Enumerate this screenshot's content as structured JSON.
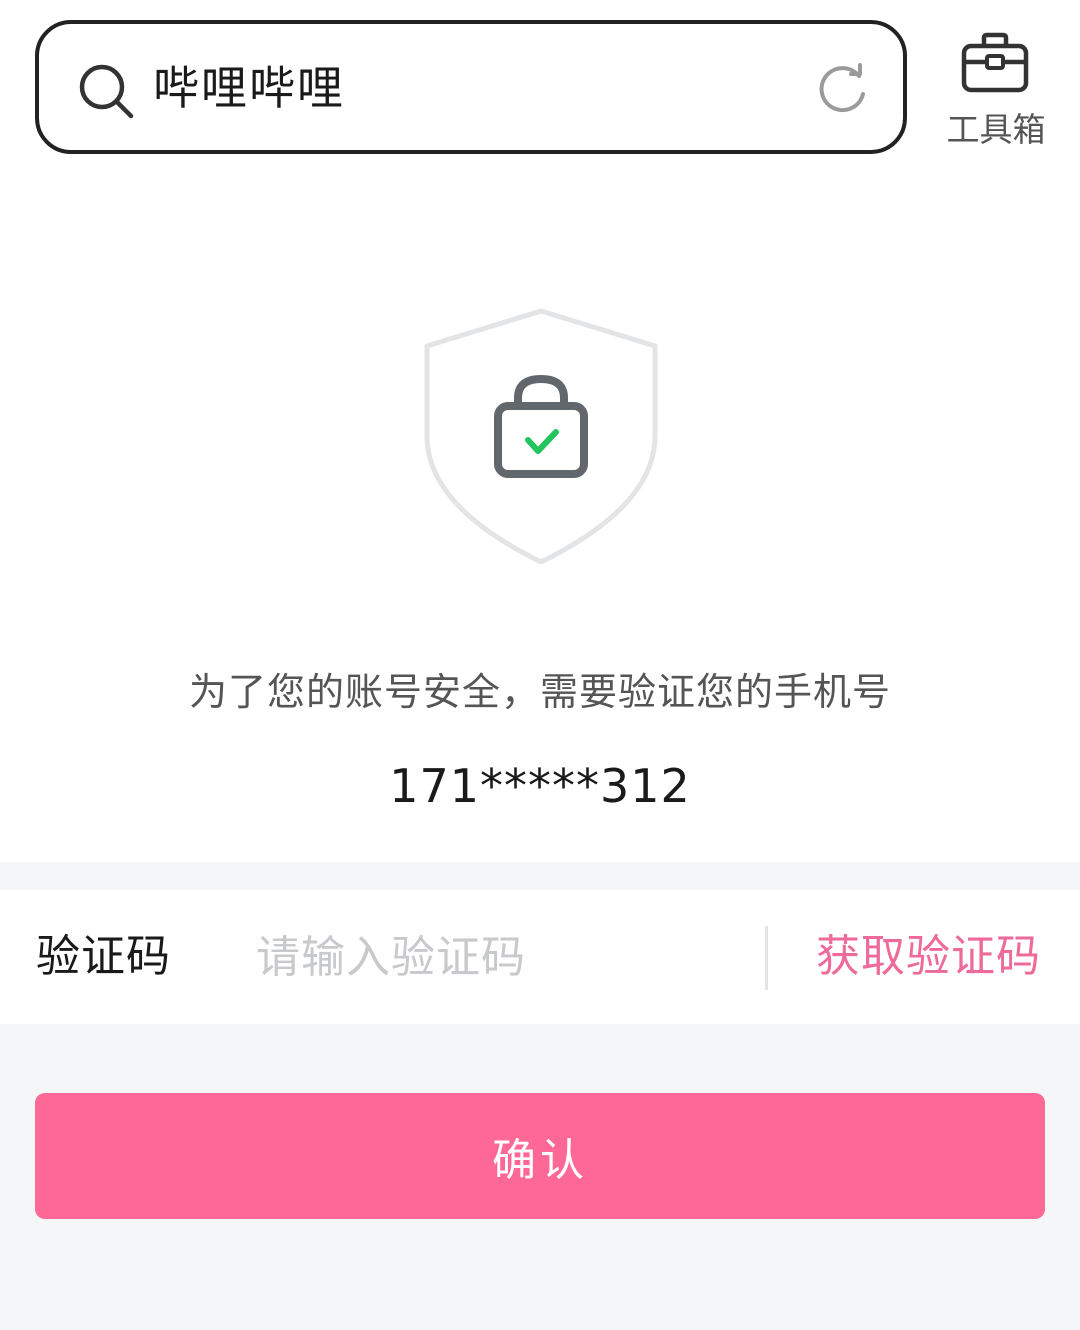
{
  "search": {
    "query": "哔哩哔哩"
  },
  "toolbox": {
    "label": "工具箱"
  },
  "verify": {
    "notice": "为了您的账号安全，需要验证您的手机号",
    "phone": "171*****312",
    "code_label": "验证码",
    "code_placeholder": "请输入验证码",
    "get_code_label": "获取验证码",
    "confirm_label": "确认"
  },
  "colors": {
    "accent": "#fe6896",
    "link": "#ee6a98",
    "check": "#22c55e",
    "background": "#f5f6f8"
  },
  "icons": [
    "search-icon",
    "refresh-icon",
    "toolbox-icon",
    "shield-icon",
    "lock-icon",
    "check-icon"
  ]
}
